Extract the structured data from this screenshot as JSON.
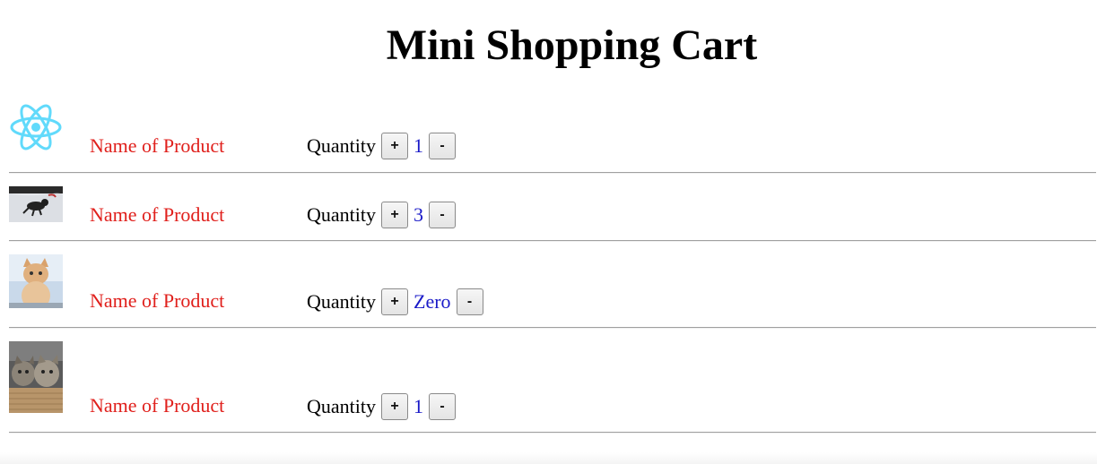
{
  "title": "Mini Shopping Cart",
  "quantity_label": "Quantity",
  "increment_label": "+",
  "decrement_label": "-",
  "items": [
    {
      "image": "react-logo-icon",
      "name": "Name of Product",
      "quantity": "1"
    },
    {
      "image": "cat-on-snow-photo",
      "name": "Name of Product",
      "quantity": "3"
    },
    {
      "image": "kitten-photo",
      "name": "Name of Product",
      "quantity": "Zero"
    },
    {
      "image": "kittens-in-basket-photo",
      "name": "Name of Product",
      "quantity": "1"
    }
  ],
  "colors": {
    "product_name": "#e0201c",
    "quantity_value": "#1a1ac8",
    "react_logo": "#61dafb"
  }
}
